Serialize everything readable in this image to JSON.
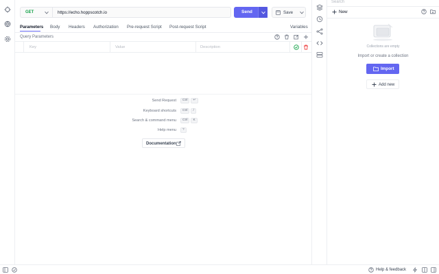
{
  "request": {
    "method": "GET",
    "url": "https://echo.hoppscotch.io",
    "send_label": "Send",
    "save_label": "Save"
  },
  "tabs": [
    {
      "label": "Parameters",
      "active": true
    },
    {
      "label": "Body",
      "active": false
    },
    {
      "label": "Headers",
      "active": false
    },
    {
      "label": "Authorization",
      "active": false
    },
    {
      "label": "Pre-request Script",
      "active": false
    },
    {
      "label": "Post-request Script",
      "active": false
    }
  ],
  "variables_label": "Variables",
  "query": {
    "title": "Query Parameters",
    "columns": {
      "key": "Key",
      "value": "Value",
      "description": "Description"
    }
  },
  "shortcuts": [
    {
      "label": "Send Request",
      "keys": [
        "Ctrl",
        "↵"
      ]
    },
    {
      "label": "Keyboard shortcuts",
      "keys": [
        "Ctrl",
        "/"
      ]
    },
    {
      "label": "Search & command menu",
      "keys": [
        "Ctrl",
        "K"
      ]
    },
    {
      "label": "Help menu",
      "keys": [
        "?"
      ]
    }
  ],
  "documentation_label": "Documentation",
  "collections": {
    "search_placeholder": "Search",
    "new_label": "New",
    "empty_text": "Collections are empty",
    "hint_text": "Import or create a collection",
    "import_label": "Import",
    "add_new_label": "Add new"
  },
  "footer": {
    "help_label": "Help & feedback"
  },
  "colors": {
    "accent": "#6366f1",
    "get_method": "#16a34a",
    "delete_red": "#ef4444"
  }
}
